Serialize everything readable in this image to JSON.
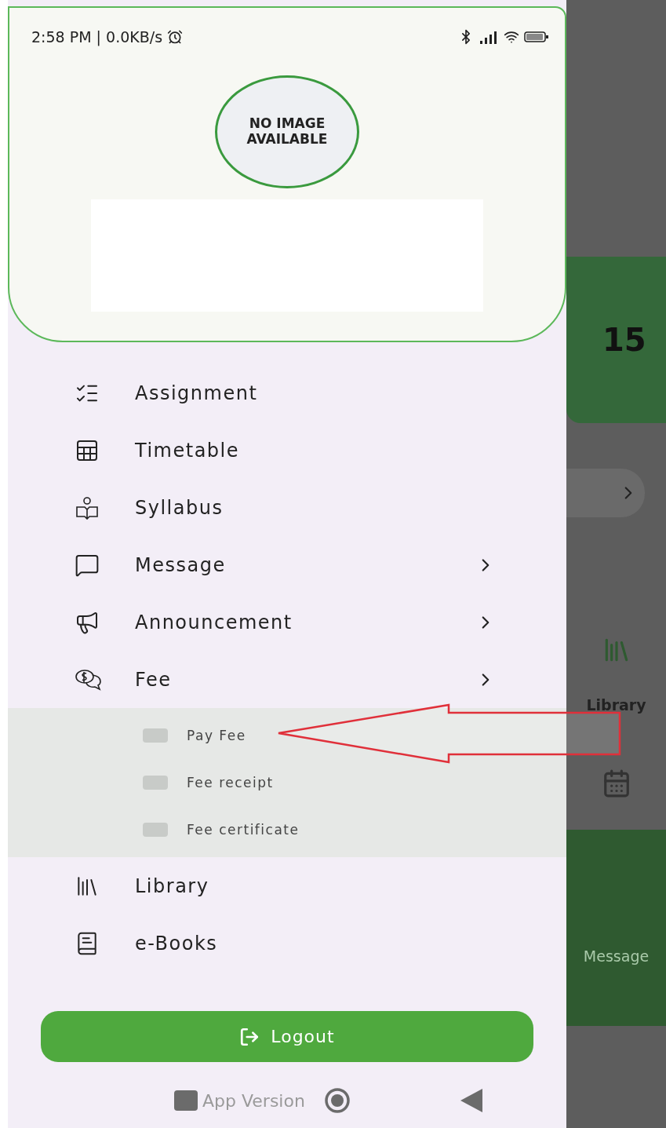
{
  "status_bar": {
    "time": "2:58 PM | 0.0KB/s"
  },
  "profile": {
    "photo_label": "NO IMAGE AVAILABLE"
  },
  "menu": [
    {
      "kind": "assignment",
      "label": "Assignment",
      "has_submenu": false
    },
    {
      "kind": "timetable",
      "label": "Timetable",
      "has_submenu": false
    },
    {
      "kind": "syllabus",
      "label": "Syllabus",
      "has_submenu": false
    },
    {
      "kind": "message",
      "label": "Message",
      "has_submenu": true,
      "expanded": false
    },
    {
      "kind": "announcement",
      "label": "Announcement",
      "has_submenu": true,
      "expanded": false
    },
    {
      "kind": "fee",
      "label": "Fee",
      "has_submenu": true,
      "expanded": true,
      "children": [
        {
          "label": "Pay Fee"
        },
        {
          "label": "Fee receipt"
        },
        {
          "label": "Fee certificate"
        }
      ]
    },
    {
      "kind": "library",
      "label": "Library",
      "has_submenu": false
    },
    {
      "kind": "ebooks",
      "label": "e-Books",
      "has_submenu": false
    }
  ],
  "logout_button": {
    "label": "Logout"
  },
  "app_version": "App Version",
  "background_screen": {
    "count": "15",
    "tile_label": "Library",
    "nav_label": "Message"
  }
}
